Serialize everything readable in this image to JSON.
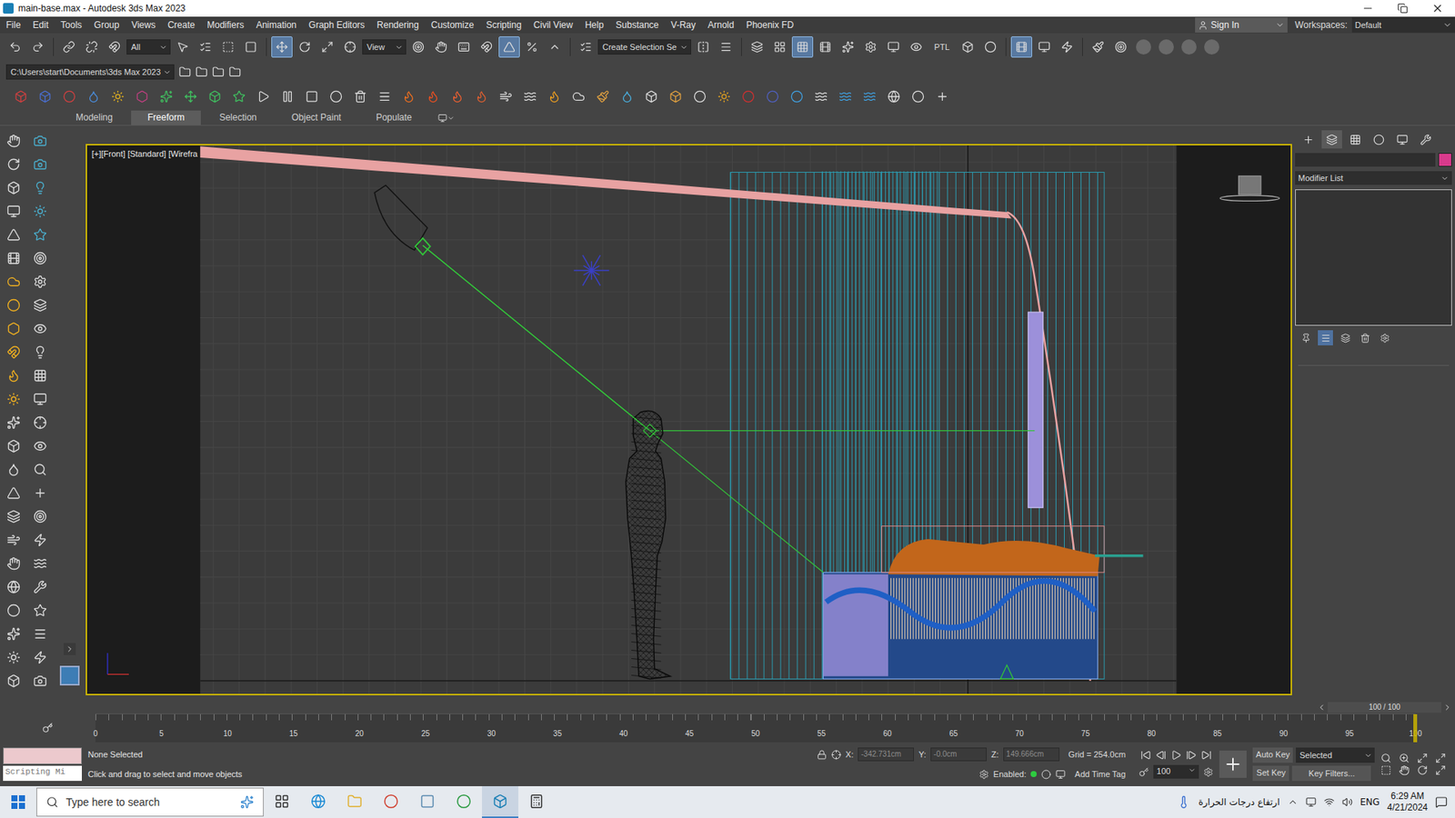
{
  "window": {
    "title": "main-base.max - Autodesk 3ds Max 2023"
  },
  "menu": [
    "File",
    "Edit",
    "Tools",
    "Group",
    "Views",
    "Create",
    "Modifiers",
    "Animation",
    "Graph Editors",
    "Rendering",
    "Customize",
    "Scripting",
    "Civil View",
    "Help",
    "Substance",
    "V-Ray",
    "Arnold",
    "Phoenix FD"
  ],
  "account": {
    "sign_in": "Sign In",
    "workspaces_label": "Workspaces:",
    "workspace": "Default"
  },
  "main_toolbar": {
    "items": [
      {
        "kind": "button",
        "active": false
      },
      {
        "kind": "button",
        "active": false
      },
      {
        "kind": "separator"
      },
      {
        "kind": "button",
        "active": false
      },
      {
        "kind": "button",
        "active": false
      },
      {
        "kind": "button",
        "active": false
      },
      {
        "kind": "dropdown",
        "text": "All"
      },
      {
        "kind": "button",
        "active": false
      },
      {
        "kind": "button",
        "active": false
      },
      {
        "kind": "button",
        "active": false
      },
      {
        "kind": "button",
        "active": false
      },
      {
        "kind": "separator"
      },
      {
        "kind": "button",
        "active": true
      },
      {
        "kind": "button",
        "active": false
      },
      {
        "kind": "button",
        "active": false
      },
      {
        "kind": "button",
        "active": false
      },
      {
        "kind": "dropdown",
        "text": "View"
      },
      {
        "kind": "button",
        "active": false
      },
      {
        "kind": "button",
        "active": false
      },
      {
        "kind": "button",
        "active": false
      },
      {
        "kind": "button",
        "active": false
      },
      {
        "kind": "button",
        "active": true
      },
      {
        "kind": "button",
        "active": false
      },
      {
        "kind": "button",
        "active": false
      },
      {
        "kind": "separator"
      },
      {
        "kind": "button",
        "active": false
      },
      {
        "kind": "dropdown",
        "text": "Create Selection Se"
      },
      {
        "kind": "button",
        "active": false
      },
      {
        "kind": "button",
        "active": false
      },
      {
        "kind": "separator"
      },
      {
        "kind": "button",
        "active": false
      },
      {
        "kind": "button",
        "active": false
      },
      {
        "kind": "button",
        "active": true
      },
      {
        "kind": "button",
        "active": false
      },
      {
        "kind": "button",
        "active": false
      },
      {
        "kind": "button",
        "active": false
      },
      {
        "kind": "button",
        "active": false
      },
      {
        "kind": "button",
        "active": false
      },
      {
        "kind": "text",
        "text": "PTL"
      },
      {
        "kind": "button",
        "active": false
      },
      {
        "kind": "button",
        "active": false
      },
      {
        "kind": "separator"
      },
      {
        "kind": "button",
        "active": true
      },
      {
        "kind": "button",
        "active": false
      },
      {
        "kind": "button",
        "active": false
      },
      {
        "kind": "separator"
      },
      {
        "kind": "button",
        "active": false
      },
      {
        "kind": "button",
        "active": false
      },
      {
        "kind": "dot"
      },
      {
        "kind": "dot"
      },
      {
        "kind": "dot"
      },
      {
        "kind": "dot"
      }
    ]
  },
  "project_path": "C:\\Users\\start\\Documents\\3ds Max 2023",
  "ribbon_tabs": [
    {
      "label": "Modeling",
      "selected": false
    },
    {
      "label": "Freeform",
      "selected": true
    },
    {
      "label": "Selection",
      "selected": false
    },
    {
      "label": "Object Paint",
      "selected": false
    },
    {
      "label": "Populate",
      "selected": false
    }
  ],
  "viewport": {
    "label": "[+][Front] [Standard] [Wirefra"
  },
  "command_panel": {
    "tabs": [
      {
        "selected": false
      },
      {
        "selected": true
      },
      {
        "selected": false
      },
      {
        "selected": false
      },
      {
        "selected": false
      },
      {
        "selected": false
      }
    ],
    "modifier_list": "Modifier List",
    "stack_tools": [
      {
        "active": false
      },
      {
        "active": true
      },
      {
        "active": false
      },
      {
        "active": false
      },
      {
        "active": false
      }
    ]
  },
  "time_slider": {
    "label": "100 / 100",
    "level": 1
  },
  "timeline": {
    "ticks": [
      "0",
      "5",
      "10",
      "15",
      "20",
      "25",
      "30",
      "35",
      "40",
      "45",
      "50",
      "55",
      "60",
      "65",
      "70",
      "75",
      "80",
      "85",
      "90",
      "95",
      "100"
    ]
  },
  "status_bar": {
    "selection": "None Selected",
    "prompt": "Click and drag to select and move objects",
    "script_listener": "Scripting Mi",
    "x_label": "X:",
    "x": "-342.731cm",
    "y_label": "Y:",
    "y": "-0.0cm",
    "z_label": "Z:",
    "z": "149.666cm",
    "grid": "Grid = 254.0cm",
    "enabled_label": "Enabled:",
    "enabled": true,
    "add_time_tag": "Add Time Tag",
    "auto_key": "Auto Key",
    "key_mode": "Selected",
    "set_key": "Set Key",
    "key_filters": "Key Filters...",
    "frame": "100"
  },
  "taskbar": {
    "search_placeholder": "Type here to search",
    "weather": "ارتفاع درجات الحرارة",
    "language": "ENG",
    "time": "6:29 AM",
    "date": "4/21/2024",
    "apps": [
      {
        "active": false
      },
      {
        "active": false
      },
      {
        "active": false
      },
      {
        "active": false
      },
      {
        "active": false
      },
      {
        "active": false
      },
      {
        "active": true
      },
      {
        "active": false
      }
    ]
  }
}
